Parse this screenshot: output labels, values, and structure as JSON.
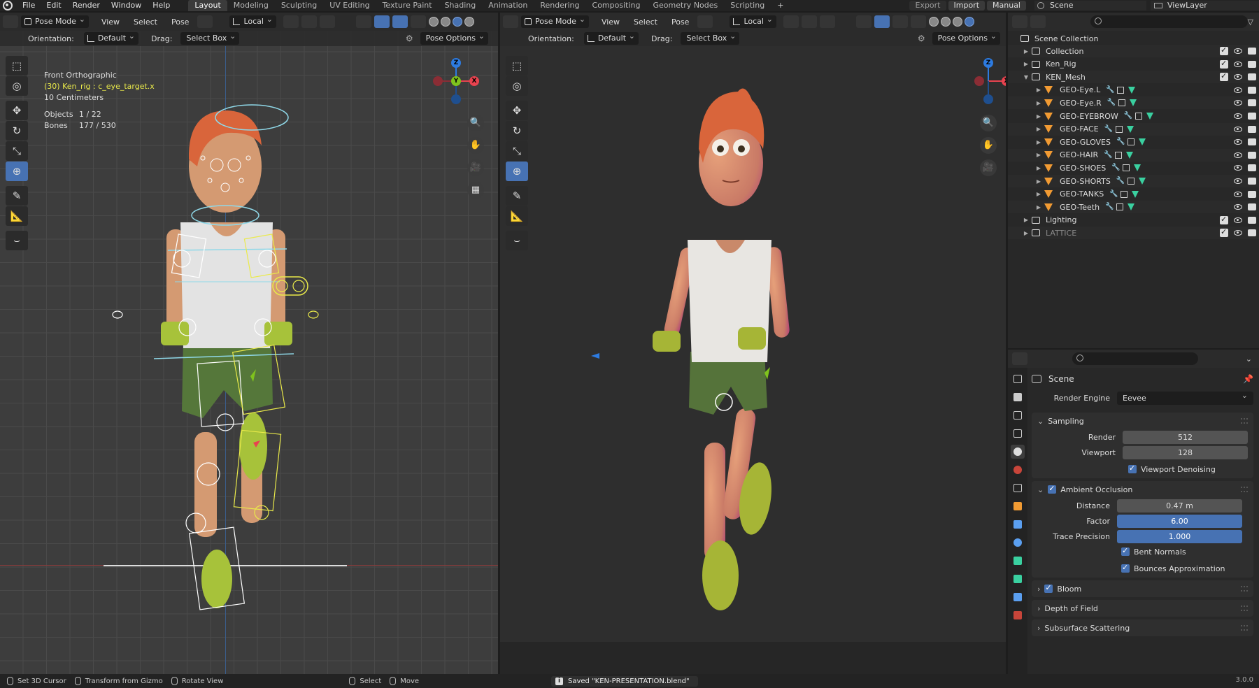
{
  "topbar": {
    "menus": [
      "File",
      "Edit",
      "Render",
      "Window",
      "Help"
    ],
    "workspaces": [
      "Layout",
      "Modeling",
      "Sculpting",
      "UV Editing",
      "Texture Paint",
      "Shading",
      "Animation",
      "Rendering",
      "Compositing",
      "Geometry Nodes",
      "Scripting"
    ],
    "active_workspace": "Layout",
    "export_label": "Export",
    "import_label": "Import",
    "manual_label": "Manual",
    "scene_name": "Scene",
    "view_layer": "ViewLayer"
  },
  "viewport_header": {
    "mode": "Pose Mode",
    "menus": [
      "View",
      "Select",
      "Pose"
    ],
    "transform_orientation": "Local",
    "orientation_label": "Orientation:",
    "orientation_value": "Default",
    "drag_label": "Drag:",
    "drag_value": "Select Box",
    "pose_options": "Pose Options"
  },
  "viewport1_info": {
    "view": "Front Orthographic",
    "active": "(30) Ken_rig : c_eye_target.x",
    "scale": "10 Centimeters",
    "objects_label": "Objects",
    "objects_value": "1 / 22",
    "bones_label": "Bones",
    "bones_value": "177 / 530"
  },
  "gizmo_axes": {
    "z": "Z",
    "y": "Y",
    "x": "X"
  },
  "outliner": {
    "root": "Scene Collection",
    "rows": [
      {
        "label": "Collection",
        "kind": "collection",
        "indent": 0
      },
      {
        "label": "Ken_Rig",
        "kind": "collection",
        "indent": 0
      },
      {
        "label": "KEN_Mesh",
        "kind": "collection",
        "indent": 0,
        "expanded": true
      },
      {
        "label": "GEO-Eye.L",
        "kind": "mesh",
        "indent": 1
      },
      {
        "label": "GEO-Eye.R",
        "kind": "mesh",
        "indent": 1
      },
      {
        "label": "GEO-EYEBROW",
        "kind": "mesh",
        "indent": 1
      },
      {
        "label": "GEO-FACE",
        "kind": "mesh",
        "indent": 1
      },
      {
        "label": "GEO-GLOVES",
        "kind": "mesh",
        "indent": 1
      },
      {
        "label": "GEO-HAIR",
        "kind": "mesh",
        "indent": 1
      },
      {
        "label": "GEO-SHOES",
        "kind": "mesh",
        "indent": 1
      },
      {
        "label": "GEO-SHORTS",
        "kind": "mesh",
        "indent": 1
      },
      {
        "label": "GEO-TANKS",
        "kind": "mesh",
        "indent": 1
      },
      {
        "label": "GEO-Teeth",
        "kind": "mesh",
        "indent": 1
      },
      {
        "label": "Lighting",
        "kind": "collection",
        "indent": 0
      },
      {
        "label": "LATTICE",
        "kind": "collection",
        "indent": 0,
        "dim": true
      }
    ]
  },
  "properties": {
    "context": "Scene",
    "render_engine_label": "Render Engine",
    "render_engine": "Eevee",
    "sampling": {
      "title": "Sampling",
      "render_label": "Render",
      "render": "512",
      "viewport_label": "Viewport",
      "viewport": "128",
      "denoise_label": "Viewport Denoising"
    },
    "ao": {
      "title": "Ambient Occlusion",
      "distance_label": "Distance",
      "distance": "0.47 m",
      "factor_label": "Factor",
      "factor": "6.00",
      "trace_label": "Trace Precision",
      "trace": "1.000",
      "bent_label": "Bent Normals",
      "bounces_label": "Bounces Approximation"
    },
    "bloom": "Bloom",
    "dof": "Depth of Field",
    "sss": "Subsurface Scattering"
  },
  "statusbar": {
    "set_cursor": "Set 3D Cursor",
    "transform": "Transform from Gizmo",
    "rotate": "Rotate View",
    "select": "Select",
    "move": "Move",
    "saved": "Saved \"KEN-PRESENTATION.blend\"",
    "version": "3.0.0"
  },
  "colors": {
    "accent": "#4772b3",
    "x_axis": "#e8434f",
    "y_axis": "#7fc21d",
    "z_axis": "#2d7be0",
    "bone_yellow": "#eaea4a",
    "shirt": "#e6e6e6",
    "shorts": "#5c7a3a",
    "shoes": "#b4c23a",
    "hair": "#d9653b"
  }
}
